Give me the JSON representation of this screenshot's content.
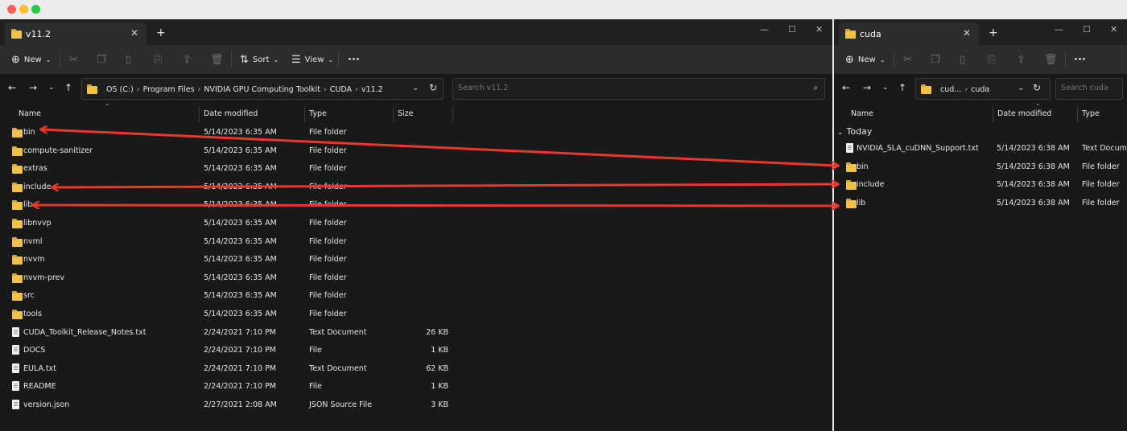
{
  "left_window": {
    "tab_title": "v11.2",
    "toolbar": {
      "new_label": "New",
      "sort_label": "Sort",
      "view_label": "View",
      "more_label": "···"
    },
    "breadcrumb": [
      "OS (C:)",
      "Program Files",
      "NVIDIA GPU Computing Toolkit",
      "CUDA",
      "v11.2"
    ],
    "search_placeholder": "Search v11.2",
    "columns": {
      "name": "Name",
      "date": "Date modified",
      "type": "Type",
      "size": "Size"
    },
    "rows": [
      {
        "name": "bin",
        "date": "5/14/2023 6:35 AM",
        "type": "File folder",
        "size": "",
        "icon": "folder-icon"
      },
      {
        "name": "compute-sanitizer",
        "date": "5/14/2023 6:35 AM",
        "type": "File folder",
        "size": "",
        "icon": "folder-icon"
      },
      {
        "name": "extras",
        "date": "5/14/2023 6:35 AM",
        "type": "File folder",
        "size": "",
        "icon": "folder-icon"
      },
      {
        "name": "include",
        "date": "5/14/2023 6:35 AM",
        "type": "File folder",
        "size": "",
        "icon": "folder-icon"
      },
      {
        "name": "lib",
        "date": "5/14/2023 6:35 AM",
        "type": "File folder",
        "size": "",
        "icon": "folder-icon"
      },
      {
        "name": "libnvvp",
        "date": "5/14/2023 6:35 AM",
        "type": "File folder",
        "size": "",
        "icon": "folder-icon"
      },
      {
        "name": "nvml",
        "date": "5/14/2023 6:35 AM",
        "type": "File folder",
        "size": "",
        "icon": "folder-icon"
      },
      {
        "name": "nvvm",
        "date": "5/14/2023 6:35 AM",
        "type": "File folder",
        "size": "",
        "icon": "folder-icon"
      },
      {
        "name": "nvvm-prev",
        "date": "5/14/2023 6:35 AM",
        "type": "File folder",
        "size": "",
        "icon": "folder-icon"
      },
      {
        "name": "src",
        "date": "5/14/2023 6:35 AM",
        "type": "File folder",
        "size": "",
        "icon": "folder-icon"
      },
      {
        "name": "tools",
        "date": "5/14/2023 6:35 AM",
        "type": "File folder",
        "size": "",
        "icon": "folder-icon"
      },
      {
        "name": "CUDA_Toolkit_Release_Notes.txt",
        "date": "2/24/2021 7:10 PM",
        "type": "Text Document",
        "size": "26 KB",
        "icon": "file-icon"
      },
      {
        "name": "DOCS",
        "date": "2/24/2021 7:10 PM",
        "type": "File",
        "size": "1 KB",
        "icon": "file-icon"
      },
      {
        "name": "EULA.txt",
        "date": "2/24/2021 7:10 PM",
        "type": "Text Document",
        "size": "62 KB",
        "icon": "file-icon"
      },
      {
        "name": "README",
        "date": "2/24/2021 7:10 PM",
        "type": "File",
        "size": "1 KB",
        "icon": "file-icon"
      },
      {
        "name": "version.json",
        "date": "2/27/2021 2:08 AM",
        "type": "JSON Source File",
        "size": "3 KB",
        "icon": "file-icon"
      }
    ]
  },
  "right_window": {
    "tab_title": "cuda",
    "toolbar": {
      "new_label": "New",
      "more_label": "···"
    },
    "breadcrumb": [
      "cud...",
      "cuda"
    ],
    "search_placeholder": "Search cuda",
    "columns": {
      "name": "Name",
      "date": "Date modified",
      "type": "Type"
    },
    "group_label": "Today",
    "rows": [
      {
        "name": "NVIDIA_SLA_cuDNN_Support.txt",
        "date": "5/14/2023 6:38 AM",
        "type": "Text Documen",
        "icon": "file-icon"
      },
      {
        "name": "bin",
        "date": "5/14/2023 6:38 AM",
        "type": "File folder",
        "icon": "folder-icon"
      },
      {
        "name": "include",
        "date": "5/14/2023 6:38 AM",
        "type": "File folder",
        "icon": "folder-icon"
      },
      {
        "name": "lib",
        "date": "5/14/2023 6:38 AM",
        "type": "File folder",
        "icon": "folder-icon"
      }
    ]
  },
  "arrows": {
    "color": "#e8372c",
    "links": [
      [
        "bin",
        "bin"
      ],
      [
        "include",
        "include"
      ],
      [
        "lib",
        "lib"
      ]
    ]
  }
}
